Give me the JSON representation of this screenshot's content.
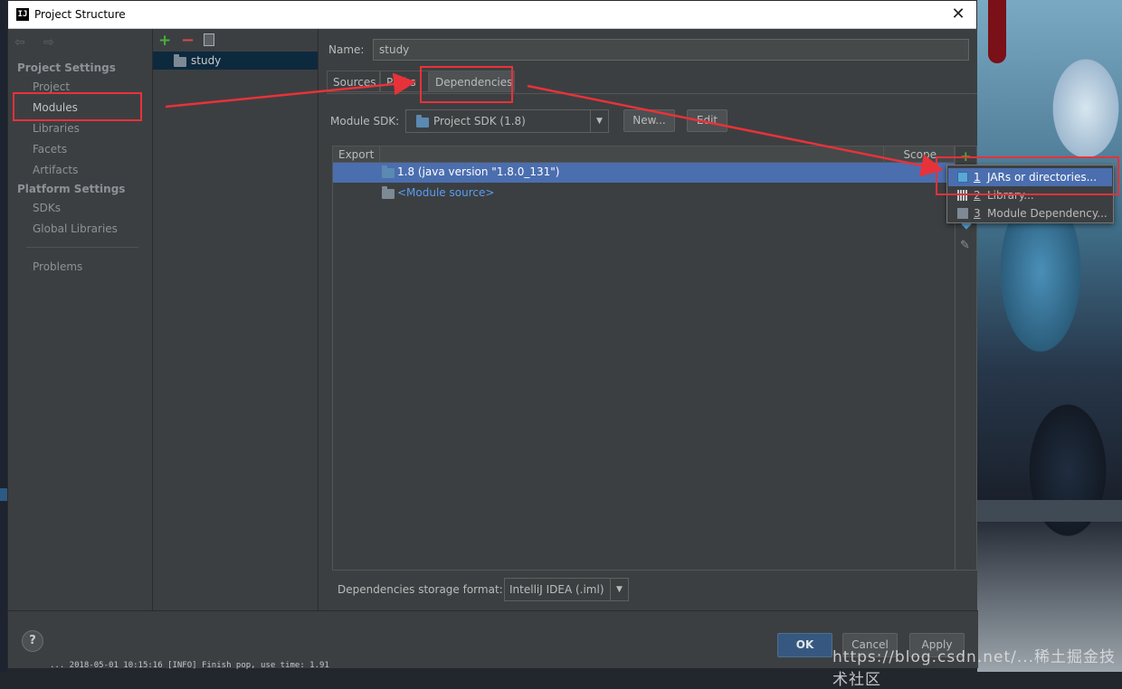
{
  "window": {
    "title": "Project Structure",
    "app_icon": "intellij-icon",
    "close_glyph": "✕"
  },
  "nav": {
    "back_forward": "⇦ ⇨",
    "sections": [
      {
        "header": "Project Settings",
        "items": [
          "Project",
          "Modules",
          "Libraries",
          "Facets",
          "Artifacts"
        ]
      },
      {
        "header": "Platform Settings",
        "items": [
          "SDKs",
          "Global Libraries"
        ]
      }
    ],
    "problems": "Problems",
    "selected": "Modules"
  },
  "tree": {
    "add": "+",
    "remove": "−",
    "module": "study"
  },
  "main": {
    "name_label": "Name:",
    "name_value": "study",
    "tabs": [
      "Sources",
      "Paths",
      "Dependencies"
    ],
    "active_tab": "Dependencies",
    "module_sdk_label": "Module SDK:",
    "module_sdk_value": "Project SDK (1.8)",
    "new_button": "New...",
    "edit_button": "Edit",
    "table": {
      "headers": [
        "Export",
        "Scope"
      ],
      "rows": [
        {
          "label": "1.8 (java version \"1.8.0_131\")",
          "selected": true
        },
        {
          "label": "<Module source>",
          "selected": false
        }
      ]
    },
    "storage_label": "Dependencies storage format:",
    "storage_value": "IntelliJ IDEA (.iml)"
  },
  "popup": {
    "items": [
      {
        "num": "1",
        "label": "JARs or directories...",
        "icon": "jar-icon"
      },
      {
        "num": "2",
        "label": "Library...",
        "icon": "library-icon"
      },
      {
        "num": "3",
        "label": "Module Dependency...",
        "icon": "module-icon"
      }
    ]
  },
  "footer": {
    "help": "?",
    "ok": "OK",
    "cancel": "Cancel",
    "apply": "Apply"
  },
  "colors": {
    "accent_red": "#e8323a",
    "selection": "#4b6eaf",
    "bg": "#3c3f41"
  },
  "watermark": "https://blog.csdn.net/...稀土掘金技术社区",
  "log_line": "... 2018-05-01 10:15:16 [INFO] Finish pop, use time: 1.91"
}
